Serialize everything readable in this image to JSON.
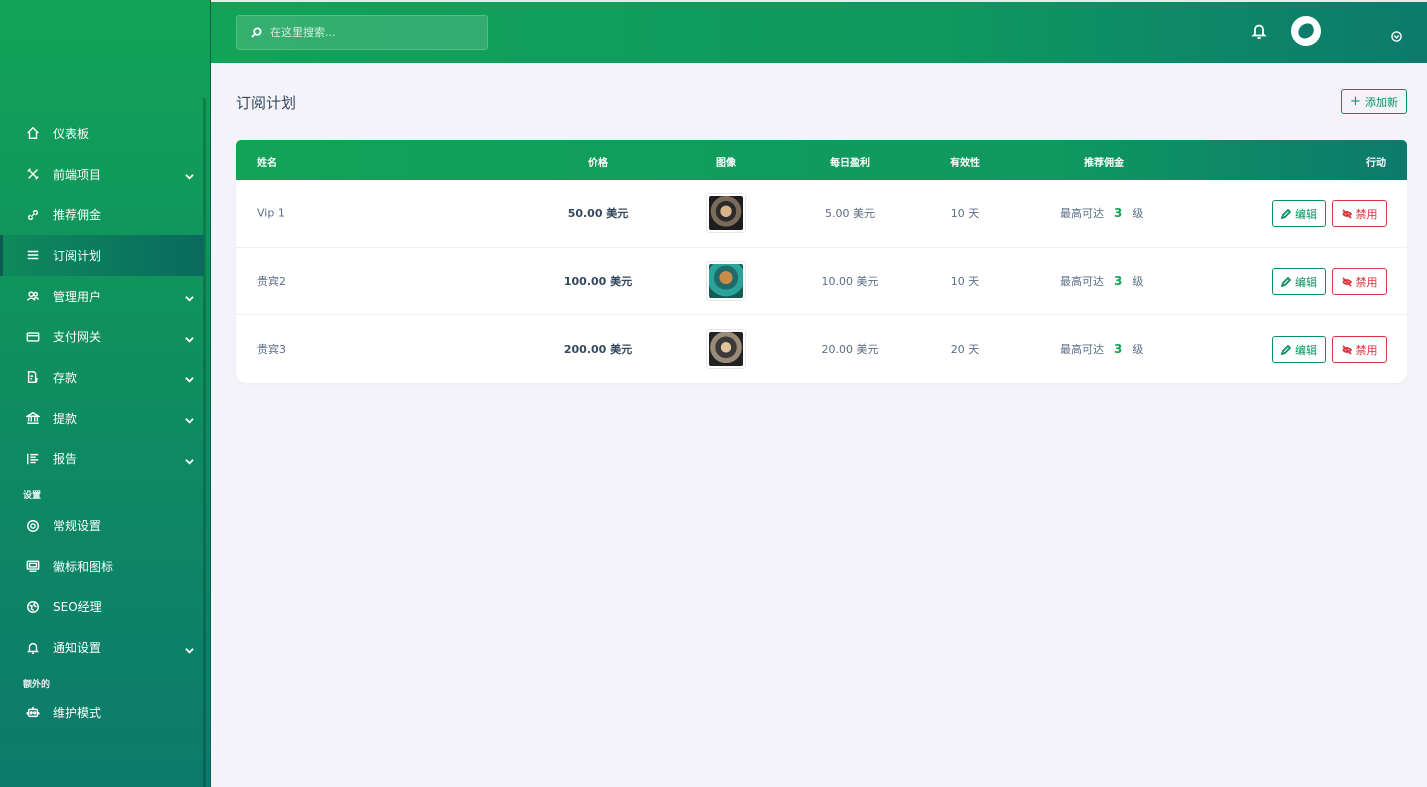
{
  "search": {
    "placeholder": "在这里搜索..."
  },
  "sidebar": {
    "items": [
      {
        "label": "仪表板",
        "icon": "home-icon",
        "expandable": false
      },
      {
        "label": "前端项目",
        "icon": "tools-icon",
        "expandable": true
      },
      {
        "label": "推荐佣金",
        "icon": "link-icon",
        "expandable": false
      },
      {
        "label": "订阅计划",
        "icon": "menu-icon",
        "expandable": false,
        "active": true
      },
      {
        "label": "管理用户",
        "icon": "users-icon",
        "expandable": true
      },
      {
        "label": "支付网关",
        "icon": "credit-card-icon",
        "expandable": true
      },
      {
        "label": "存款",
        "icon": "deposit-icon",
        "expandable": true
      },
      {
        "label": "提款",
        "icon": "bank-icon",
        "expandable": true
      },
      {
        "label": "报告",
        "icon": "list-icon",
        "expandable": true
      }
    ],
    "settings_section": "设置",
    "settings_items": [
      {
        "label": "常规设置",
        "icon": "lifebuoy-icon",
        "expandable": false
      },
      {
        "label": "徽标和图标",
        "icon": "image-icon",
        "expandable": false
      },
      {
        "label": "SEO经理",
        "icon": "globe-icon",
        "expandable": false
      },
      {
        "label": "通知设置",
        "icon": "bell-icon",
        "expandable": true
      }
    ],
    "extra_section": "额外的",
    "extra_items": [
      {
        "label": "维护模式",
        "icon": "robot-icon",
        "expandable": false
      }
    ]
  },
  "page": {
    "title": "订阅计划",
    "add_button": "添加新"
  },
  "table": {
    "columns": [
      "姓名",
      "价格",
      "图像",
      "每日盈利",
      "有效性",
      "推荐佣金",
      "行动"
    ],
    "rows": [
      {
        "name": "Vip 1",
        "price": "50.00 美元",
        "daily_profit": "5.00 美元",
        "validity": "10 天",
        "level_prefix": "最高可达",
        "level_num": "3",
        "level_suffix": "级",
        "edit": "编辑",
        "disable": "禁用"
      },
      {
        "name": "贵宾2",
        "price": "100.00 美元",
        "daily_profit": "10.00 美元",
        "validity": "10 天",
        "level_prefix": "最高可达",
        "level_num": "3",
        "level_suffix": "级",
        "edit": "编辑",
        "disable": "禁用"
      },
      {
        "name": "贵宾3",
        "price": "200.00 美元",
        "daily_profit": "20.00 美元",
        "validity": "20 天",
        "level_prefix": "最高可达",
        "level_num": "3",
        "level_suffix": "级",
        "edit": "编辑",
        "disable": "禁用"
      }
    ]
  },
  "colors": {
    "brand": "#13a356",
    "brand_dark": "#0c7a6c",
    "danger": "#d9363e"
  }
}
